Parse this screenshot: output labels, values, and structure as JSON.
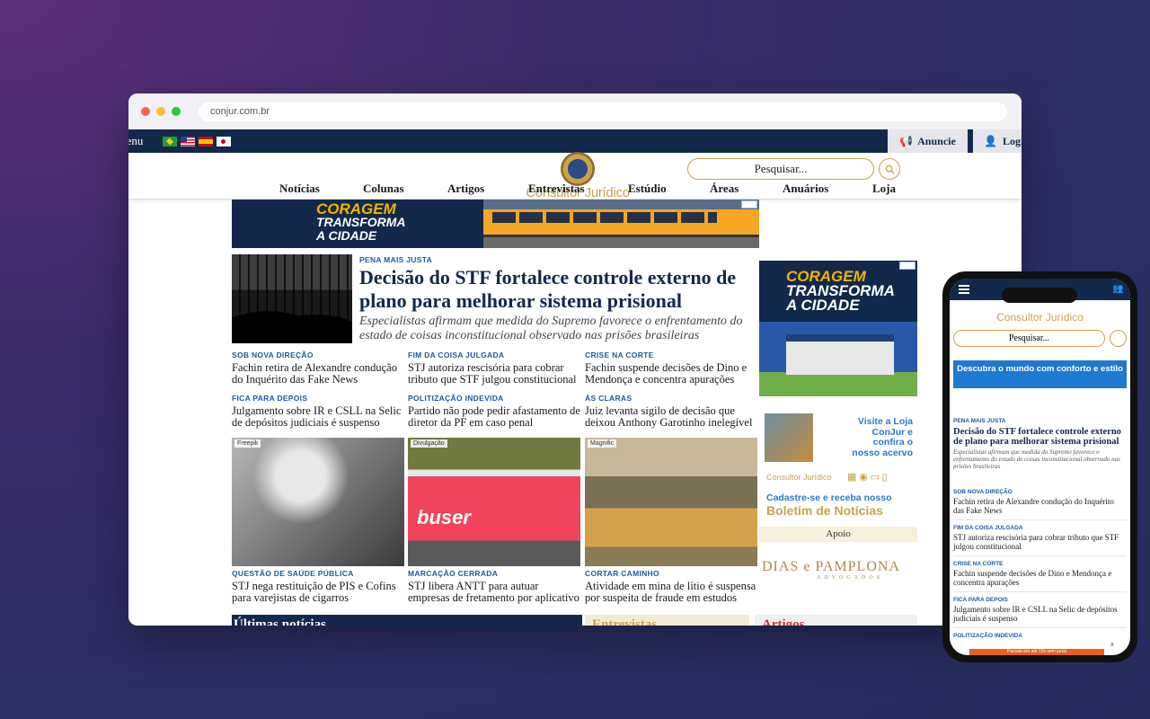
{
  "browser": {
    "url": "conjur.com.br"
  },
  "topbar": {
    "menu": "Menu",
    "anuncie": "Anuncie",
    "login": "Login"
  },
  "header": {
    "logo": "Consultor Jurídico",
    "search_placeholder": "Pesquisar..."
  },
  "nav": {
    "items": [
      "Notícias",
      "Colunas",
      "Artigos",
      "Entrevistas",
      "Estúdio",
      "Áreas",
      "Anuários",
      "Loja"
    ]
  },
  "banner": {
    "line1": "CORAGEM",
    "line2": "TRANSFORMA",
    "line3": "A CIDADE"
  },
  "main_story": {
    "kicker": "PENA MAIS JUSTA",
    "title": "Decisão do STF fortalece controle externo de plano para melhorar sistema prisional",
    "subtitle": "Especialistas afirmam que medida do Supremo favorece o enfrentamento do estado de coisas inconstitucional observado nas prisões brasileiras"
  },
  "stories": [
    {
      "kicker": "SOB NOVA DIREÇÃO",
      "title": "Fachin retira de Alexandre condução do Inquérito das Fake News"
    },
    {
      "kicker": "FIM DA COISA JULGADA",
      "title": "STJ autoriza rescisória para cobrar tributo que STF julgou constitucional"
    },
    {
      "kicker": "CRISE NA CORTE",
      "title": "Fachin suspende decisões de Dino e Mendonça e concentra apurações"
    },
    {
      "kicker": "FICA PARA DEPOIS",
      "title": "Julgamento sobre IR e CSLL na Selic de depósitos judiciais é suspenso"
    },
    {
      "kicker": "POLITIZAÇÃO INDEVIDA",
      "title": "Partido não pode pedir afastamento de diretor da PF em caso penal"
    },
    {
      "kicker": "ÀS CLARAS",
      "title": "Juiz levanta sigilo de decisão que deixou Anthony Garotinho inelegível"
    }
  ],
  "photo_stories": [
    {
      "credit": "Freepik",
      "kicker": "QUESTÃO DE SAÚDE PÚBLICA",
      "title": "STJ nega restituição de PIS e Cofins para varejistas de cigarros"
    },
    {
      "credit": "Divulgação",
      "kicker": "MARCAÇÃO CERRADA",
      "title": "STJ libera ANTT para autuar empresas de fretamento por aplicativo",
      "brand": "buser"
    },
    {
      "credit": "Magnific",
      "kicker": "CORTAR CAMINHO",
      "title": "Atividade em mina de lítio é suspensa por suspeita de fraude em estudos"
    }
  ],
  "bottom_sections": [
    "Últimas notícias",
    "Entrevistas",
    "Artigos"
  ],
  "sidebar": {
    "ad_line1": "CORAGEM",
    "ad_line2": "TRANSFORMA",
    "ad_line3": "A CIDADE",
    "loja": "Visite a Loja ConJur e confira o nosso acervo",
    "boletim_a": "Cadastre-se e receba nosso",
    "boletim_b": "Boletim de Notícias",
    "apoio": "Apoio",
    "sponsor": "DIAS e PAMPLONA",
    "sponsor_sub": "ADVOGADOS"
  },
  "phone": {
    "logo": "Consultor Jurídico",
    "search_placeholder": "Pesquisar...",
    "ad": "Descubra o mundo com conforto e estilo",
    "main_kicker": "PENA MAIS JUSTA",
    "main_title": "Decisão do STF fortalece controle externo de plano para melhorar sistema prisional",
    "main_sub": "Especialistas afirmam que medida do Supremo favorece o enfrentamento do estado de coisas inconstitucional observado nas prisões brasileiras",
    "cookie": "Parcele em até 10x sem juros"
  },
  "colors": {
    "navy": "#13294b",
    "gold": "#c9a349",
    "link_blue": "#1e5a9e"
  }
}
